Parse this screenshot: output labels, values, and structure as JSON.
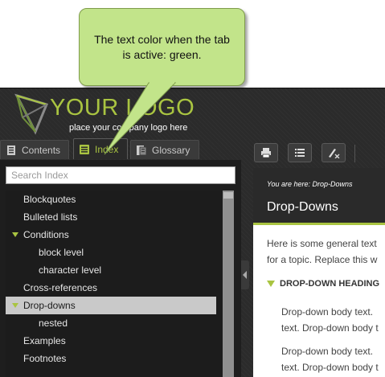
{
  "callout": {
    "text_line1": "The text color when the tab",
    "text_line2": "is active: green.",
    "fill": "#c2e48a"
  },
  "header": {
    "logo_text": "YOUR LOGO",
    "tagline": "place your company logo here",
    "logo_color": "#a9c441"
  },
  "tabs": [
    {
      "label": "Contents",
      "icon": "book-icon",
      "active": false
    },
    {
      "label": "Index",
      "icon": "index-list-icon",
      "active": true
    },
    {
      "label": "Glossary",
      "icon": "glossary-icon",
      "active": false
    }
  ],
  "search": {
    "placeholder": "Search Index",
    "value": ""
  },
  "index": {
    "items": [
      {
        "label": "Blockquotes",
        "level": 0,
        "expanded": false,
        "selected": false
      },
      {
        "label": "Bulleted lists",
        "level": 0,
        "expanded": false,
        "selected": false
      },
      {
        "label": "Conditions",
        "level": 0,
        "expanded": true,
        "selected": false
      },
      {
        "label": "block level",
        "level": 1,
        "expanded": false,
        "selected": false
      },
      {
        "label": "character level",
        "level": 1,
        "expanded": false,
        "selected": false
      },
      {
        "label": "Cross-references",
        "level": 0,
        "expanded": false,
        "selected": false
      },
      {
        "label": "Drop-downs",
        "level": 0,
        "expanded": true,
        "selected": true
      },
      {
        "label": "nested",
        "level": 1,
        "expanded": false,
        "selected": false
      },
      {
        "label": "Examples",
        "level": 0,
        "expanded": false,
        "selected": false
      },
      {
        "label": "Footnotes",
        "level": 0,
        "expanded": false,
        "selected": false
      }
    ]
  },
  "toolbar": {
    "buttons": [
      {
        "name": "print-icon"
      },
      {
        "name": "list-icon"
      },
      {
        "name": "clear-highlight-icon"
      }
    ]
  },
  "content": {
    "breadcrumb": "You are here: Drop-Downs",
    "page_title": "Drop-Downs",
    "intro_line1": "Here is some general text",
    "intro_line2": "for a topic. Replace this w",
    "dropdown_heading": "DROP-DOWN HEADING",
    "dd_lines": [
      "Drop-down body text.",
      "text. Drop-down body t",
      "Drop-down body text.",
      "text. Drop-down body t"
    ]
  },
  "colors": {
    "active_tab_text": "#a9c441",
    "accent": "#a9c441",
    "dark_bg": "#2b2b2b"
  }
}
